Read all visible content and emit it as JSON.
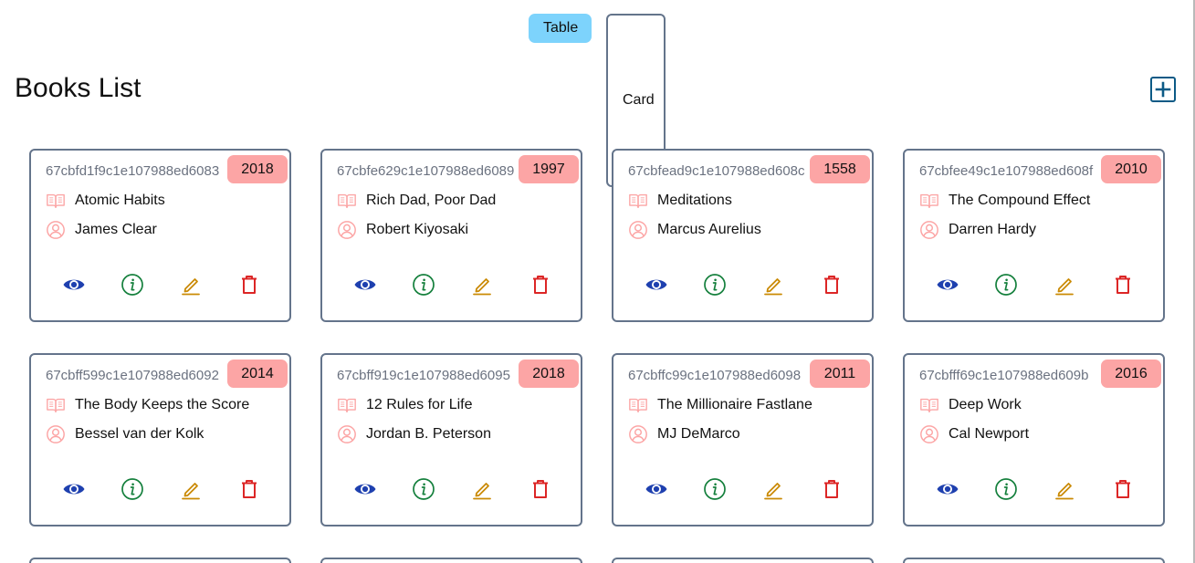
{
  "view_toggle": {
    "table_label": "Table",
    "card_label": "Card"
  },
  "header": {
    "title": "Books List",
    "add_icon": "plus-square-icon"
  },
  "colors": {
    "toggle_bg": "#7dd3fc",
    "badge_bg": "#fca5a5",
    "card_border": "#64748b",
    "view": "#1e40af",
    "info": "#15803d",
    "edit": "#ca8a04",
    "delete": "#dc2626",
    "meta_icon": "#fca5a5"
  },
  "icons": {
    "title": "book-icon",
    "author": "user-circle-icon",
    "view": "eye-icon",
    "info": "info-circle-icon",
    "edit": "pencil-icon",
    "delete": "trash-icon"
  },
  "books": [
    {
      "id": "67cbfd1f9c1e107988ed6083",
      "year": "2018",
      "title": "Atomic Habits",
      "author": "James Clear"
    },
    {
      "id": "67cbfe629c1e107988ed6089",
      "year": "1997",
      "title": "Rich Dad, Poor Dad",
      "author": "Robert Kiyosaki"
    },
    {
      "id": "67cbfead9c1e107988ed608c",
      "year": "1558",
      "title": "Meditations",
      "author": "Marcus Aurelius"
    },
    {
      "id": "67cbfee49c1e107988ed608f",
      "year": "2010",
      "title": "The Compound Effect",
      "author": "Darren Hardy"
    },
    {
      "id": "67cbff599c1e107988ed6092",
      "year": "2014",
      "title": "The Body Keeps the Score",
      "author": "Bessel van der Kolk"
    },
    {
      "id": "67cbff919c1e107988ed6095",
      "year": "2018",
      "title": "12 Rules for Life",
      "author": "Jordan B. Peterson"
    },
    {
      "id": "67cbffc99c1e107988ed6098",
      "year": "2011",
      "title": "The Millionaire Fastlane",
      "author": "MJ DeMarco"
    },
    {
      "id": "67cbfff69c1e107988ed609b",
      "year": "2016",
      "title": "Deep Work",
      "author": "Cal Newport"
    }
  ]
}
